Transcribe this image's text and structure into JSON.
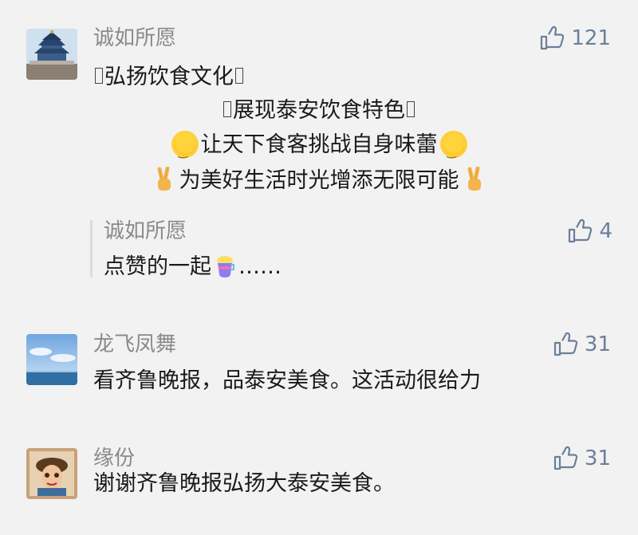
{
  "comments": [
    {
      "username": "诚如所愿",
      "likes": "121",
      "lines": [
        "弘扬饮食文化",
        "展现泰安饮食特色",
        "让天下食客挑战自身味蕾",
        "为美好生活时光增添无限可能"
      ],
      "avatar_icon": "temple-of-heaven-avatar",
      "reply": {
        "username": "诚如所愿",
        "likes": "4",
        "text_before": "点赞的一起",
        "text_after": "……"
      }
    },
    {
      "username": "龙飞凤舞",
      "likes": "31",
      "text": "看齐鲁晚报，品泰安美食。这活动很给力",
      "avatar_icon": "sky-sea-avatar"
    },
    {
      "username": "缘份",
      "likes": "31",
      "text": "谢谢齐鲁晚报弘扬大泰安美食。",
      "avatar_icon": "cartoon-character-avatar"
    }
  ],
  "colors": {
    "background": "#f2f2f2",
    "username": "#8a8a8a",
    "like": "#6b7f99",
    "text": "#1a1a1a"
  },
  "icons": {
    "like": "thumbs-up-icon",
    "sun": "sun-emoji-icon",
    "victory": "victory-hand-emoji-icon",
    "drink": "bubble-tea-emoji-icon"
  }
}
